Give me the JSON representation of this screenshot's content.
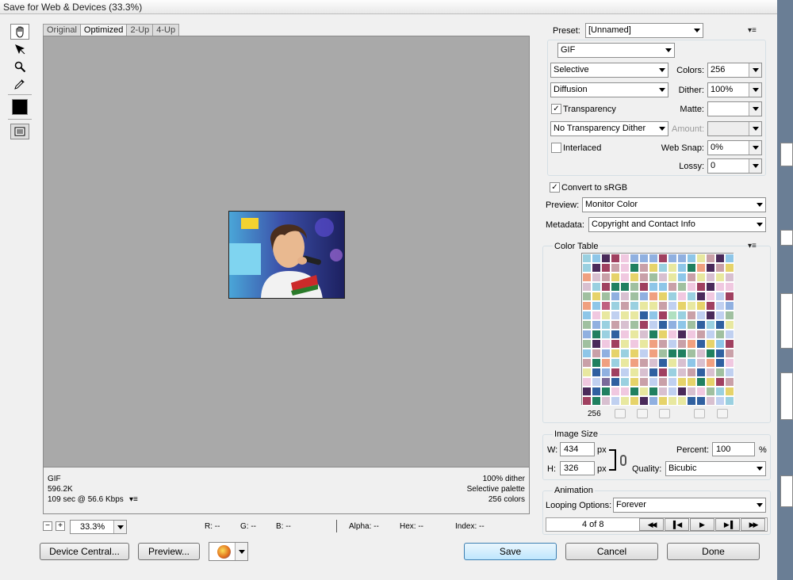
{
  "window": {
    "title": "Save for Web & Devices (33.3%)"
  },
  "tabs": [
    "Original",
    "Optimized",
    "2-Up",
    "4-Up"
  ],
  "info": {
    "format": "GIF",
    "size": "596.2K",
    "time": "109 sec @ 56.6 Kbps",
    "dither": "100% dither",
    "palette": "Selective palette",
    "colors": "256 colors"
  },
  "statusbar": {
    "zoom": "33.3%",
    "r": "R: --",
    "g": "G: --",
    "b": "B: --",
    "alpha": "Alpha: --",
    "hex": "Hex: --",
    "index": "Index: --"
  },
  "settings": {
    "preset_label": "Preset:",
    "preset_value": "[Unnamed]",
    "format": "GIF",
    "reduction": "Selective",
    "colors_label": "Colors:",
    "colors_value": "256",
    "dither_algo": "Diffusion",
    "dither_label": "Dither:",
    "dither_value": "100%",
    "transparency": "Transparency",
    "matte_label": "Matte:",
    "matte_value": "",
    "trans_dither": "No Transparency Dither",
    "amount_label": "Amount:",
    "amount_value": "",
    "interlaced": "Interlaced",
    "websnap_label": "Web Snap:",
    "websnap_value": "0%",
    "lossy_label": "Lossy:",
    "lossy_value": "0",
    "convert_srgb": "Convert to sRGB",
    "preview_label": "Preview:",
    "preview_value": "Monitor Color",
    "metadata_label": "Metadata:",
    "metadata_value": "Copyright and Contact Info"
  },
  "color_table": {
    "title": "Color Table",
    "count": "256"
  },
  "image_size": {
    "title": "Image Size",
    "w_label": "W:",
    "w_value": "434",
    "h_label": "H:",
    "h_value": "326",
    "unit": "px",
    "percent_label": "Percent:",
    "percent_value": "100",
    "percent_unit": "%",
    "quality_label": "Quality:",
    "quality_value": "Bicubic"
  },
  "animation": {
    "title": "Animation",
    "looping_label": "Looping Options:",
    "looping_value": "Forever",
    "frame": "4 of 8"
  },
  "buttons": {
    "device_central": "Device Central...",
    "preview": "Preview...",
    "save": "Save",
    "cancel": "Cancel",
    "done": "Done"
  },
  "colors": {
    "canvas": "#a9a9a9",
    "panel": "#f0f0f0",
    "accent": "#3c7fb1"
  }
}
